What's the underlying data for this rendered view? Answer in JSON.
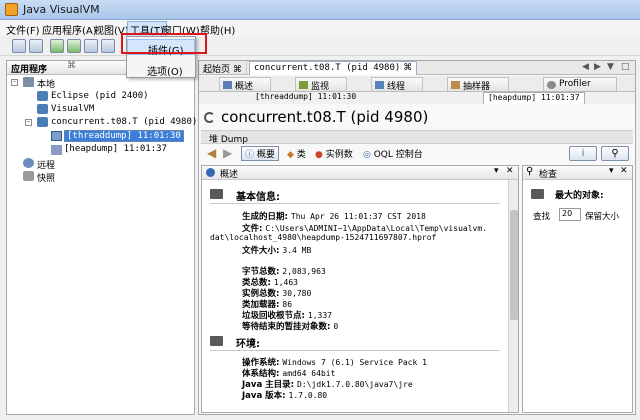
{
  "window": {
    "title": "Java VisualVM"
  },
  "menu": {
    "file": "文件(F)",
    "apps": "应用程序(A)",
    "view": "视图(V)",
    "tools": "工具(T)",
    "window": "窗口(W)",
    "help": "帮助(H)"
  },
  "dropdown": {
    "plugins": "插件(G)",
    "options": "选项(O)"
  },
  "left": {
    "tab_label": "应用程序",
    "tab_close": "⌘",
    "minimize": "—",
    "tree": {
      "local": "本地",
      "eclipse": "Eclipse (pid 2400)",
      "visualvm": "VisualVM",
      "concurrent": "concurrent.t08.T (pid 4980)",
      "threaddump": "[threaddump] 11:01:30",
      "heapdump": "[heapdump] 11:01:37",
      "remote": "远程",
      "snapshots": "快照"
    }
  },
  "right": {
    "tabs": {
      "start": "起始页",
      "start_close": "⌘",
      "process": "concurrent.t08.T (pid 4980)",
      "process_close": "⌘",
      "nav_left": "◀",
      "nav_right": "▶",
      "nav_menu": "▼",
      "nav_restore": "□"
    },
    "subtabs": {
      "overview": "概述",
      "monitor": "监视",
      "threads": "线程",
      "sampler": "抽样器",
      "profiler": "Profiler"
    },
    "doctabs": {
      "threaddump": "[threaddump] 11:01:30",
      "heapdump": "[heapdump] 11:01:37"
    },
    "heading": "concurrent.t08.T (pid 4980)",
    "subheading": "堆 Dump",
    "viewbar": {
      "back": "◀",
      "forward": "▶",
      "summary": "概要",
      "classes": "类",
      "instances": "实例数",
      "oql": "OQL 控制台",
      "info_btn": "i",
      "search_btn": "⚲"
    },
    "summary": {
      "title": "概述",
      "basic_info": "基本信息:",
      "date_label": "生成的日期:",
      "date_value": "Thu Apr 26 11:01:37 CST 2018",
      "file_label": "文件:",
      "file_value": "C:\\Users\\ADMINI~1\\AppData\\Local\\Temp\\visualvm.",
      "file_value2": "dat\\localhost_4980\\heapdump-1524711697807.hprof",
      "size_label": "文件大小:",
      "size_value": "3.4 MB",
      "bytes_label": "字节总数:",
      "bytes_value": "2,083,963",
      "classes_label": "类总数:",
      "classes_value": "1,463",
      "instances_label": "实例总数:",
      "instances_value": "30,780",
      "loaders_label": "类加载器:",
      "loaders_value": "86",
      "gcroots_label": "垃圾回收根节点:",
      "gcroots_value": "1,337",
      "pending_label": "等待结束的暂挂对象数:",
      "pending_value": "0",
      "env": "环境:",
      "os_label": "操作系统:",
      "os_value": "Windows 7 (6.1) Service Pack 1",
      "arch_label": "体系结构:",
      "arch_value": "amd64 64bit",
      "home_label": "Java 主目录:",
      "home_value": "D:\\jdk1.7.0.80\\java7\\jre",
      "version_label": "Java 版本:",
      "version_value": "1.7.0.80"
    },
    "inspect": {
      "title": "检查",
      "biggest": "最大的对象:",
      "find": "查找",
      "count": "20",
      "retain": "保留大小"
    }
  }
}
